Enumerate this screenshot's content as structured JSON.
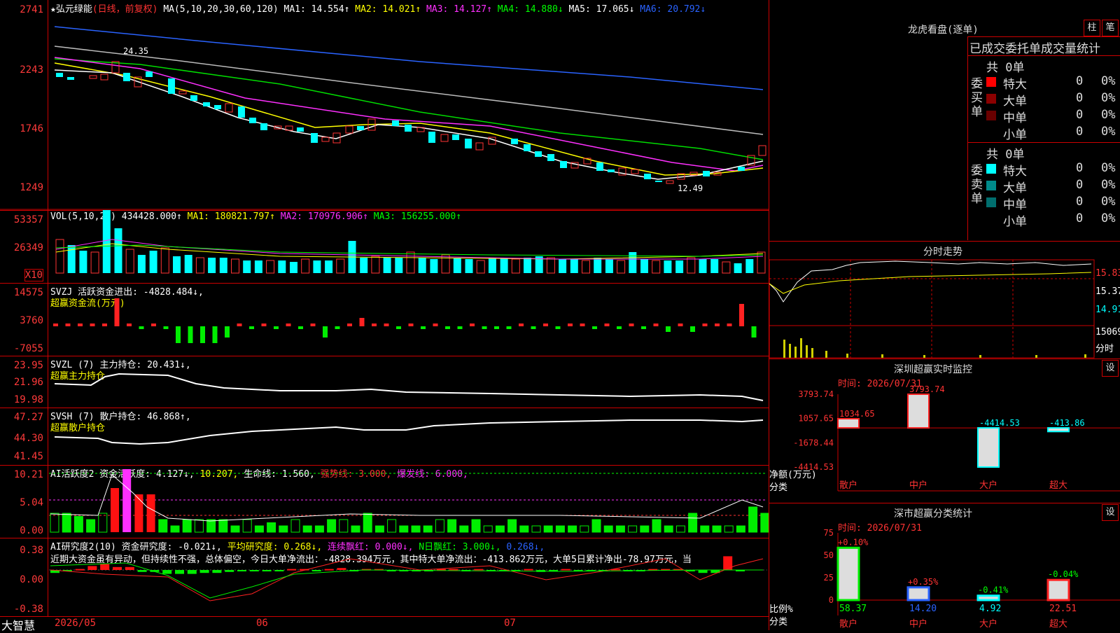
{
  "main": {
    "header": {
      "star": "★",
      "name": "弘元绿能",
      "period": "(日线，前复权)",
      "ma_label": "MA(5,10,20,30,60,120)",
      "ma1": "MA1: 14.554↑",
      "ma2": "MA2: 14.021↑",
      "ma3": "MA3: 14.127↑",
      "ma4": "MA4: 14.880↓",
      "ma5": "MA5: 17.065↓",
      "ma6": "MA6: 20.792↓"
    },
    "y_ticks": [
      "2741",
      "2243",
      "1746",
      "1249"
    ],
    "hi_label": "24.35",
    "lo_label": "12.49"
  },
  "vol": {
    "header": "VOL(5,10,20)",
    "value": "434428.000↑",
    "ma1": "MA1: 180821.797↑",
    "ma2": "MA2: 170976.906↑",
    "ma3": "MA3: 156255.000↑",
    "y_ticks": [
      "53357",
      "26349"
    ],
    "unit": "X10"
  },
  "svzj": {
    "header": "SVZJ  活跃资金进出: -4828.484↓,",
    "sub": "超赢资金流(万元)",
    "y_ticks": [
      "14575",
      "3760",
      "-7055"
    ]
  },
  "svzl": {
    "header": "SVZL (7) 主力持仓: 20.431↓,",
    "sub": "超赢主力持仓",
    "y_ticks": [
      "23.95",
      "21.96",
      "19.98"
    ]
  },
  "svsh": {
    "header": "SVSH (7) 散户持仓: 46.868↑,",
    "sub": "超赢散户持仓",
    "y_ticks": [
      "47.27",
      "44.30",
      "41.45"
    ]
  },
  "ai2": {
    "header_a": "AI活跃度2 资金活跃度: 4.127↓,",
    "header_b": "10.207,",
    "header_c": "生命线: 1.560,",
    "header_d": "强势线: 3.000,",
    "header_e": "爆发线: 6.000,",
    "y_ticks": [
      "10.21",
      "5.04",
      "0.00"
    ]
  },
  "ai_res": {
    "header_a": "AI研究度2(10) 资金研究度: -0.021↓,",
    "header_b": "平均研究度: 0.268↓,",
    "header_c": "连续飘红: 0.000↓,",
    "header_d": "N日飘红: 3.000↓,",
    "header_e": "0.268↓,",
    "comment": "近期大资金虽有异动，但持续性不强，总体偏空，今日大单净流出：-4828.394万元，其中特大单净流出：-413.862万元，大单5日累计净出-78.97万元，当",
    "y_ticks": [
      "0.38",
      "0.00",
      "-0.38"
    ]
  },
  "bottom": {
    "logo": "大智慧",
    "date1": "2026/05",
    "date2": "06",
    "date3": "07"
  },
  "right": {
    "lhb_title": "龙虎看盘(逐单)",
    "btn_zhu": "柱",
    "btn_bi": "笔",
    "stats_title": "已成交委托单成交量统计",
    "buy": {
      "side": "委买单",
      "total": "共 0单",
      "rows": [
        {
          "label": "特大",
          "n": "0",
          "p": "0%",
          "color": "#ff0000"
        },
        {
          "label": "大单",
          "n": "0",
          "p": "0%",
          "color": "#8b0000"
        },
        {
          "label": "中单",
          "n": "0",
          "p": "0%",
          "color": "#6a0000"
        },
        {
          "label": "小单",
          "n": "0",
          "p": "0%",
          "color": "#000000"
        }
      ]
    },
    "sell": {
      "side": "委卖单",
      "total": "共 0单",
      "rows": [
        {
          "label": "特大",
          "n": "0",
          "p": "0%",
          "color": "#00ffff"
        },
        {
          "label": "大单",
          "n": "0",
          "p": "0%",
          "color": "#008b8b"
        },
        {
          "label": "中单",
          "n": "0",
          "p": "0%",
          "color": "#006e6e"
        },
        {
          "label": "小单",
          "n": "0",
          "p": "0%",
          "color": "#000000"
        }
      ]
    },
    "intraday": {
      "title": "分时走势",
      "y1": "15.83",
      "y2": "15.37",
      "y3": "14.91",
      "vol": "15069",
      "unit": "分时"
    },
    "sz_monitor": {
      "title": "深圳超赢实时监控",
      "btn": "设",
      "time": "时间: 2026/07/31",
      "y_ticks": [
        "3793.74",
        "1057.65",
        "-1678.44",
        "-4414.53"
      ],
      "ylabel": "净额(万元)",
      "xlabel": "分类",
      "categories": [
        "散户",
        "中户",
        "大户",
        "超大"
      ],
      "values": [
        1034.65,
        3793.74,
        -4414.53,
        -413.86
      ],
      "labels": [
        "1034.65",
        "3793.74",
        "-4414.53",
        "-413.86"
      ]
    },
    "sz_class": {
      "title": "深市超赢分类统计",
      "btn": "设",
      "time": "时间: 2026/07/31",
      "y_ticks": [
        "75",
        "50",
        "25",
        "0"
      ],
      "ylabel": "比例%",
      "xlabel": "分类",
      "categories": [
        "散户",
        "中户",
        "大户",
        "超大"
      ],
      "values": [
        58.37,
        14.2,
        4.92,
        22.51
      ],
      "changes": [
        "+0.10%",
        "+0.35%",
        "-0.41%",
        "-0.04%"
      ],
      "labels": [
        "58.37",
        "14.20",
        "4.92",
        "22.51"
      ]
    }
  },
  "chart_data": [
    {
      "type": "bar",
      "title": "深圳超赢实时监控",
      "categories": [
        "散户",
        "中户",
        "大户",
        "超大"
      ],
      "values": [
        1034.65,
        3793.74,
        -4414.53,
        -413.86
      ],
      "ylabel": "净额(万元)",
      "xlabel": "分类",
      "ylim": [
        -4414.53,
        3793.74
      ]
    },
    {
      "type": "bar",
      "title": "深市超赢分类统计",
      "categories": [
        "散户",
        "中户",
        "大户",
        "超大"
      ],
      "values": [
        58.37,
        14.2,
        4.92,
        22.51
      ],
      "ylabel": "比例%",
      "xlabel": "分类",
      "ylim": [
        0,
        75
      ]
    }
  ]
}
